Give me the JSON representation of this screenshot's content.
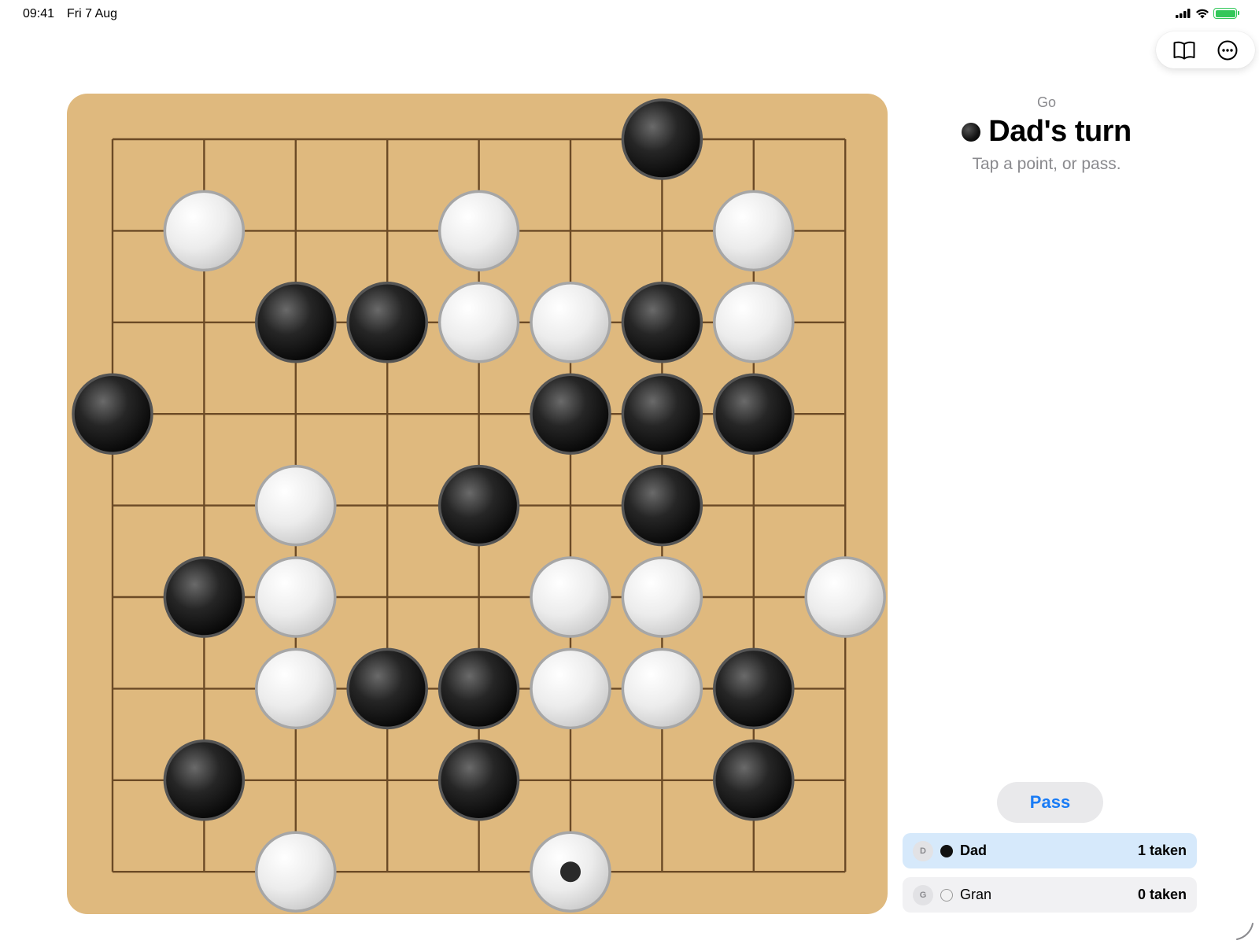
{
  "status_bar": {
    "time": "09:41",
    "date": "Fri 7 Aug"
  },
  "toolbar": {
    "icons": [
      "book-icon",
      "more-icon"
    ]
  },
  "game": {
    "name": "Go",
    "turn_title": "Dad's turn",
    "turn_color": "black",
    "hint": "Tap a point, or pass.",
    "pass_label": "Pass"
  },
  "board": {
    "size": 9,
    "last_move": {
      "col": 5,
      "row": 8
    },
    "stones": [
      {
        "col": 6,
        "row": 0,
        "color": "black"
      },
      {
        "col": 1,
        "row": 1,
        "color": "white"
      },
      {
        "col": 4,
        "row": 1,
        "color": "white"
      },
      {
        "col": 7,
        "row": 1,
        "color": "white"
      },
      {
        "col": 2,
        "row": 2,
        "color": "black"
      },
      {
        "col": 3,
        "row": 2,
        "color": "black"
      },
      {
        "col": 4,
        "row": 2,
        "color": "white"
      },
      {
        "col": 5,
        "row": 2,
        "color": "white"
      },
      {
        "col": 6,
        "row": 2,
        "color": "black"
      },
      {
        "col": 7,
        "row": 2,
        "color": "white"
      },
      {
        "col": 0,
        "row": 3,
        "color": "black"
      },
      {
        "col": 5,
        "row": 3,
        "color": "black"
      },
      {
        "col": 6,
        "row": 3,
        "color": "black"
      },
      {
        "col": 7,
        "row": 3,
        "color": "black"
      },
      {
        "col": 2,
        "row": 4,
        "color": "white"
      },
      {
        "col": 4,
        "row": 4,
        "color": "black"
      },
      {
        "col": 6,
        "row": 4,
        "color": "black"
      },
      {
        "col": 1,
        "row": 5,
        "color": "black"
      },
      {
        "col": 2,
        "row": 5,
        "color": "white"
      },
      {
        "col": 5,
        "row": 5,
        "color": "white"
      },
      {
        "col": 6,
        "row": 5,
        "color": "white"
      },
      {
        "col": 8,
        "row": 5,
        "color": "white"
      },
      {
        "col": 2,
        "row": 6,
        "color": "white"
      },
      {
        "col": 3,
        "row": 6,
        "color": "black"
      },
      {
        "col": 4,
        "row": 6,
        "color": "black"
      },
      {
        "col": 5,
        "row": 6,
        "color": "white"
      },
      {
        "col": 6,
        "row": 6,
        "color": "white"
      },
      {
        "col": 7,
        "row": 6,
        "color": "black"
      },
      {
        "col": 1,
        "row": 7,
        "color": "black"
      },
      {
        "col": 4,
        "row": 7,
        "color": "black"
      },
      {
        "col": 7,
        "row": 7,
        "color": "black"
      },
      {
        "col": 2,
        "row": 8,
        "color": "white"
      },
      {
        "col": 5,
        "row": 8,
        "color": "white"
      }
    ]
  },
  "players": [
    {
      "initial": "D",
      "name": "Dad",
      "stone": "black",
      "taken": "1 taken",
      "active": true
    },
    {
      "initial": "G",
      "name": "Gran",
      "stone": "white",
      "taken": "0 taken",
      "active": false
    }
  ]
}
